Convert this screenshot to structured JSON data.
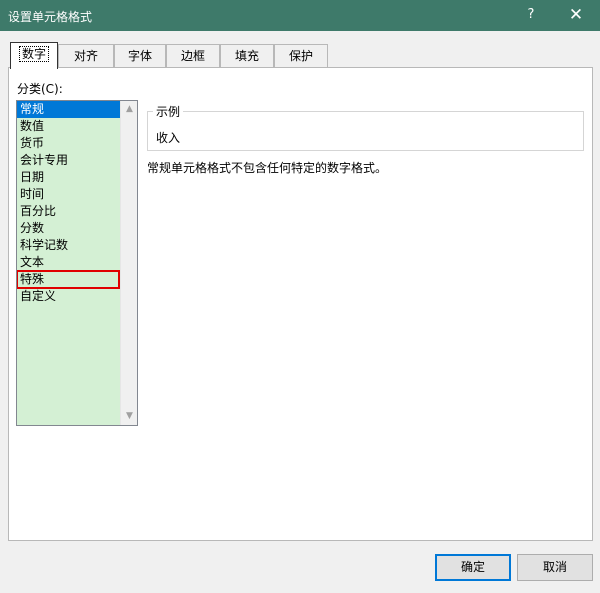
{
  "window": {
    "title": "设置单元格格式",
    "help_glyph": "?",
    "close_glyph": "✕"
  },
  "tabs": [
    {
      "label": "数字"
    },
    {
      "label": "对齐"
    },
    {
      "label": "字体"
    },
    {
      "label": "边框"
    },
    {
      "label": "填充"
    },
    {
      "label": "保护"
    }
  ],
  "category": {
    "label": "分类(C):",
    "items": [
      "常规",
      "数值",
      "货币",
      "会计专用",
      "日期",
      "时间",
      "百分比",
      "分数",
      "科学记数",
      "文本",
      "特殊",
      "自定义"
    ],
    "selected_index": 0,
    "highlighted_index": 10
  },
  "sample": {
    "legend": "示例",
    "value": "收入"
  },
  "description": "常规单元格格式不包含任何特定的数字格式。",
  "buttons": {
    "ok": "确定",
    "cancel": "取消"
  },
  "colors": {
    "titlebar": "#3e7a6a",
    "list_background": "#d4f0d4",
    "selection": "#0078d7",
    "highlight_box": "#e00000"
  }
}
